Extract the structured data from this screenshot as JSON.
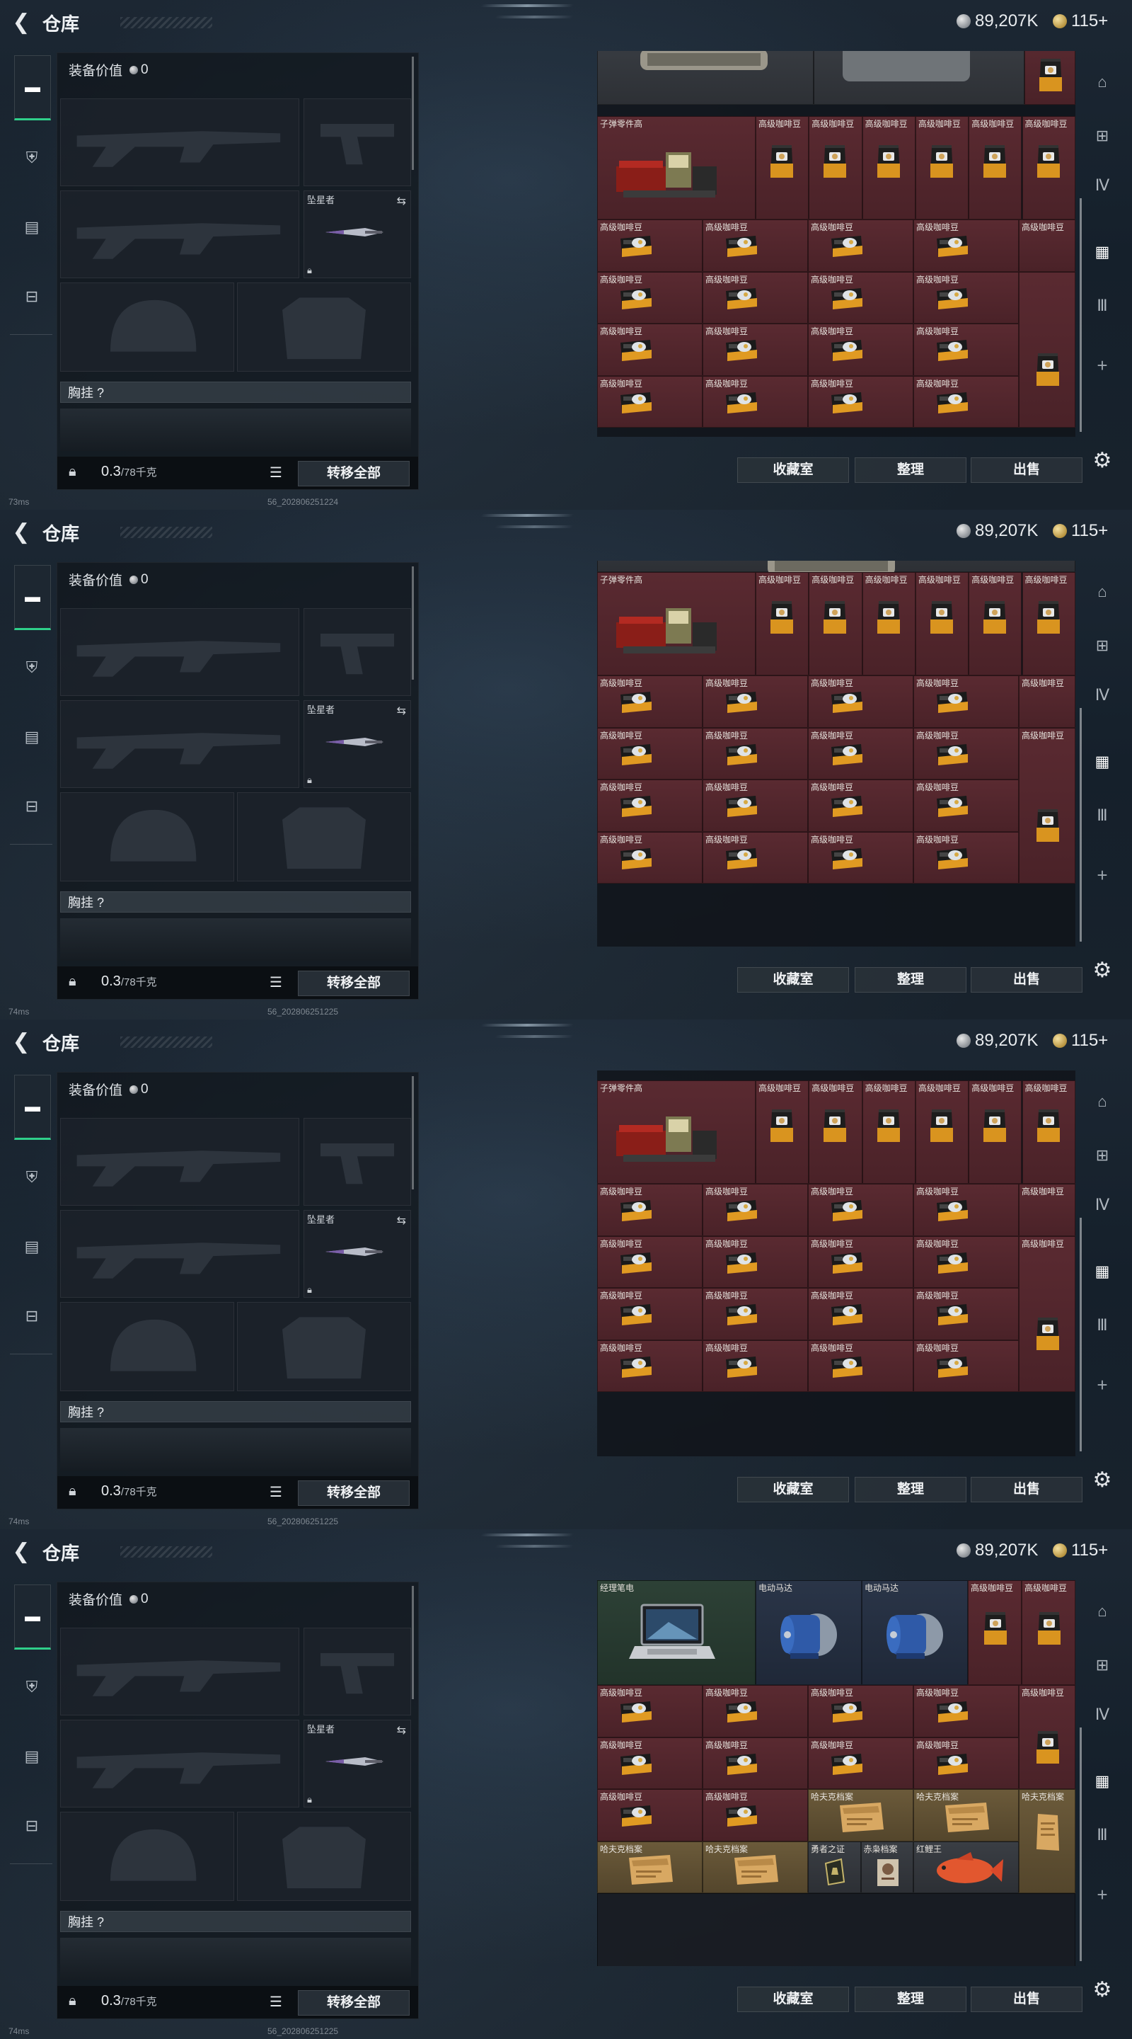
{
  "header": {
    "title": "仓库",
    "silver": "89,207K",
    "gold": "115+"
  },
  "equipment": {
    "value_label": "装备价值",
    "value": "0",
    "melee_label": "坠星者",
    "chest_label": "胸挂 ?",
    "weight": "0.3",
    "weight_max": "/78千克",
    "transfer_label": "转移全部"
  },
  "buttons": {
    "collection": "收藏室",
    "organize": "整理",
    "sell": "出售"
  },
  "frames": [
    {
      "ping": "73ms",
      "build": "56_202806251224"
    },
    {
      "ping": "74ms",
      "build": "56_202806251225"
    },
    {
      "ping": "74ms",
      "build": "56_202806251225"
    },
    {
      "ping": "74ms",
      "build": "56_202806251225"
    }
  ],
  "items": {
    "ammo_parts": "子弹零件高",
    "coffee": "高级咖啡豆",
    "laptop": "经理笔电",
    "motor": "电动马达",
    "hafu": "哈夫克档案",
    "hero": "勇者之证",
    "red": "赤枭档案",
    "carp": "红鲤王"
  },
  "colors": {
    "accent": "#2fcf8a",
    "cell": "#4e252b"
  }
}
